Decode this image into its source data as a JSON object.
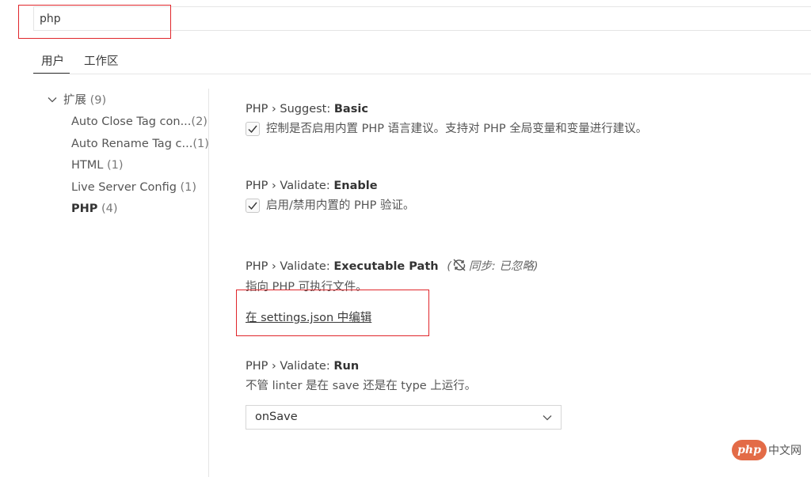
{
  "search": {
    "value": "php"
  },
  "tabs": [
    {
      "label": "用户",
      "active": true
    },
    {
      "label": "工作区",
      "active": false
    }
  ],
  "tree": {
    "root": {
      "label": "扩展",
      "count": "(9)",
      "expanded": true
    },
    "items": [
      {
        "label": "Auto Close Tag con...",
        "count": "(2)"
      },
      {
        "label": "Auto Rename Tag c...",
        "count": "(1)"
      },
      {
        "label": "HTML",
        "count": "(1)"
      },
      {
        "label": "Live Server Config",
        "count": "(1)"
      },
      {
        "label": "PHP",
        "count": "(4)",
        "selected": true
      }
    ]
  },
  "settings": [
    {
      "category": "PHP › Suggest: ",
      "name": "Basic",
      "type": "checkbox",
      "checked": true,
      "description": "控制是否启用内置 PHP 语言建议。支持对 PHP 全局变量和变量进行建议。"
    },
    {
      "category": "PHP › Validate: ",
      "name": "Enable",
      "type": "checkbox",
      "checked": true,
      "description": "启用/禁用内置的 PHP 验证。"
    },
    {
      "category": "PHP › Validate: ",
      "name": "Executable Path",
      "sync_note": "同步: 已忽略)",
      "sync_note_prefix": "(",
      "type": "link",
      "description": "指向 PHP 可执行文件。",
      "link_label": "在 settings.json 中编辑"
    },
    {
      "category": "PHP › Validate: ",
      "name": "Run",
      "type": "select",
      "description": "不管 linter 是在 save 还是在 type 上运行。",
      "selected_value": "onSave"
    }
  ],
  "watermark": {
    "badge": "php",
    "text": "中文网"
  },
  "colors": {
    "highlight_box": "#e0262b",
    "watermark_badge": "#e36b47"
  }
}
